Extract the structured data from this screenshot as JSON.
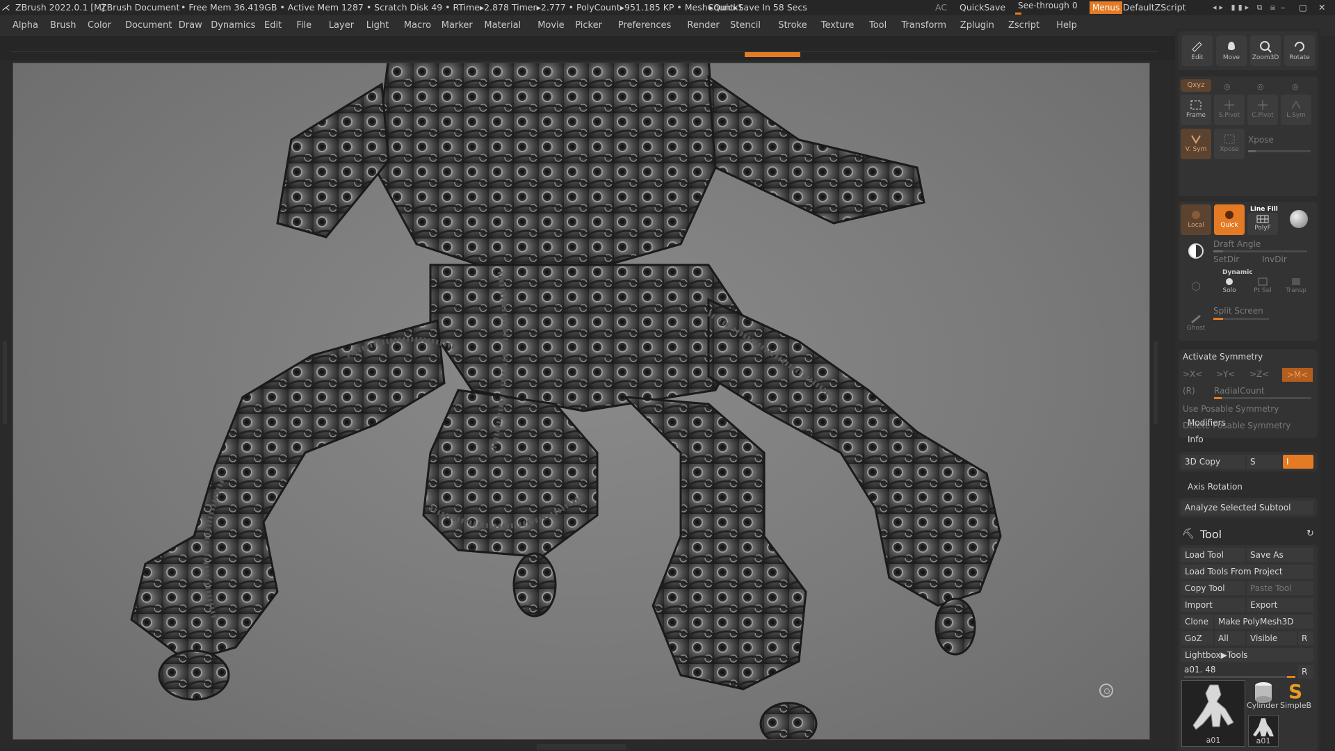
{
  "titlebar": {
    "app_title": "ZBrush 2022.0.1 [M]",
    "document": "ZBrush Document",
    "stats": "• Free Mem 36.419GB • Active Mem 1287 • Scratch Disk 49 • RTime▸2.878 Timer▸2.777 • PolyCount▸951.185 KP • MeshCount▸1",
    "quicksave_status": "▸QuickSave In 58 Secs",
    "ac": "AC",
    "quicksave": "QuickSave",
    "see_through": "See-through",
    "see_through_value": "0",
    "see_through_level": 0.1,
    "menus": "Menus",
    "script": "DefaultZScript",
    "accent": "#e47b24"
  },
  "menus": [
    "Alpha",
    "Brush",
    "Color",
    "Document",
    "Draw",
    "Dynamics",
    "Edit",
    "File",
    "Layer",
    "Light",
    "Macro",
    "Marker",
    "Material",
    "Movie",
    "Picker",
    "Preferences",
    "Render",
    "Stencil",
    "Stroke",
    "Texture",
    "Tool",
    "Transform",
    "Zplugin",
    "Zscript",
    "Help"
  ],
  "nav_buttons": [
    {
      "label": "Edit",
      "icon": "edit-icon"
    },
    {
      "label": "Move",
      "icon": "move-icon"
    },
    {
      "label": "Zoom3D",
      "icon": "zoom-icon"
    },
    {
      "label": "Rotate",
      "icon": "rotate-icon"
    }
  ],
  "panel": {
    "xyz": "Qxyz",
    "frame": "Frame",
    "spivot": "S.Pivot",
    "cpivot": "C.Pivot",
    "lsym": "L.Sym",
    "vsym": "V. Sym",
    "xpose_btn": "Xpose",
    "xpose": "Xpose",
    "local": "Local",
    "quick": "Quick",
    "line_fill": "Line Fill",
    "polyf": "PolyF",
    "draft_angle": "Draft Angle",
    "setdir": "SetDir",
    "invdir": "InvDir",
    "dynamic": "Dynamic",
    "solo": "Solo",
    "ptsel": "Pt Sel",
    "transp": "Transp",
    "ghost": "Ghost",
    "split_screen": "Split Screen",
    "activate_symmetry": "Activate Symmetry",
    "sym_x": ">X<",
    "sym_y": ">Y<",
    "sym_z": ">Z<",
    "sym_m": ">M<",
    "sym_r": "(R)",
    "radial_count": "RadialCount",
    "use_posable": "Use Posable Symmetry",
    "delete_posable": "Delete Posable Symmetry",
    "modifiers": "Modifiers",
    "info": "Info",
    "copy3d": "3D Copy",
    "copy_s": "S",
    "copy_i": "I",
    "axis_rotation": "Axis Rotation",
    "analyze": "Analyze Selected Subtool"
  },
  "tool": {
    "header": "Tool",
    "load_tool": "Load Tool",
    "save_as": "Save As",
    "load_from_project": "Load Tools From Project",
    "copy_tool": "Copy Tool",
    "paste_tool": "Paste Tool",
    "import": "Import",
    "export": "Export",
    "clone": "Clone",
    "make_polymesh": "Make PolyMesh3D",
    "goz": "GoZ",
    "all": "All",
    "visible": "Visible",
    "r": "R",
    "lightbox": "Lightbox▶Tools",
    "current": "a01. 48",
    "current_r": "R",
    "thumb_main": "a01",
    "thumb_cylinder": "Cylinder",
    "thumb_simpleb": "SimpleB",
    "thumb_small": "a01"
  }
}
